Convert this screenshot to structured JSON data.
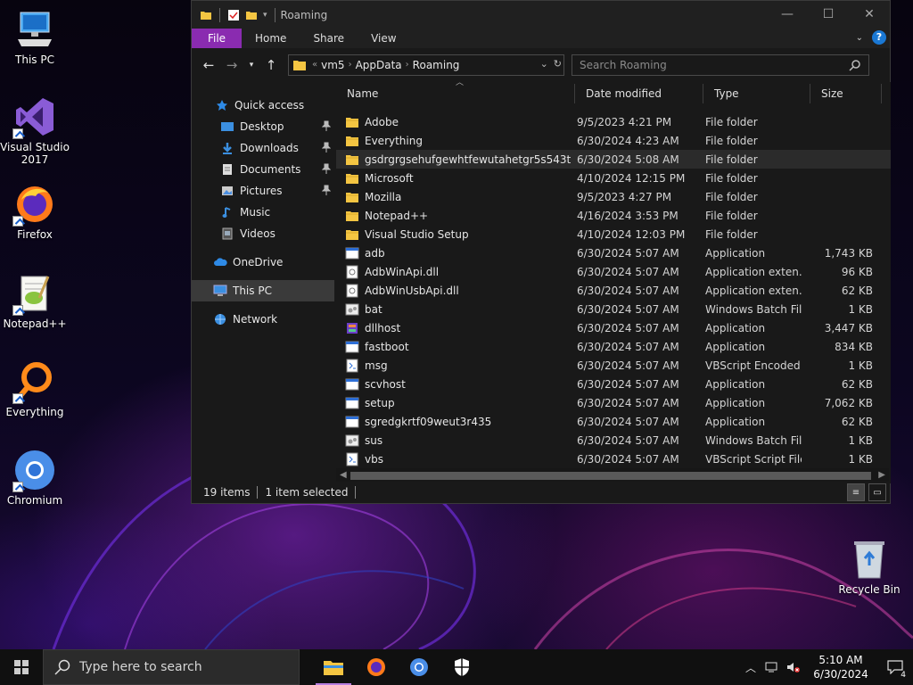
{
  "desktop": {
    "icons": [
      {
        "label": "This PC",
        "icon": "computer-icon"
      },
      {
        "label": "Visual Studio\n2017",
        "icon": "visual-studio-icon"
      },
      {
        "label": "Firefox",
        "icon": "firefox-icon"
      },
      {
        "label": "Notepad++",
        "icon": "notepadpp-icon"
      },
      {
        "label": "Everything",
        "icon": "everything-icon"
      },
      {
        "label": "Chromium",
        "icon": "chromium-icon"
      }
    ],
    "recycle_bin": "Recycle Bin"
  },
  "window": {
    "title": "Roaming",
    "ribbon_tabs": [
      "File",
      "Home",
      "Share",
      "View"
    ],
    "help_label": "?",
    "address": {
      "overflow": "«",
      "crumbs": [
        "vm5",
        "AppData",
        "Roaming"
      ]
    },
    "search": {
      "placeholder": "Search Roaming"
    },
    "nav_pane": {
      "items": [
        {
          "label": "Quick access",
          "icon": "star-icon"
        },
        {
          "label": "Desktop",
          "icon": "desktop-folder-icon",
          "pinned": true
        },
        {
          "label": "Downloads",
          "icon": "download-icon",
          "pinned": true
        },
        {
          "label": "Documents",
          "icon": "documents-icon",
          "pinned": true
        },
        {
          "label": "Pictures",
          "icon": "pictures-icon",
          "pinned": true
        },
        {
          "label": "Music",
          "icon": "music-icon"
        },
        {
          "label": "Videos",
          "icon": "videos-icon"
        },
        {
          "label": "OneDrive",
          "icon": "cloud-icon"
        },
        {
          "label": "This PC",
          "icon": "computer-icon",
          "selected": true
        },
        {
          "label": "Network",
          "icon": "network-icon"
        }
      ]
    },
    "columns": {
      "name": "Name",
      "date": "Date modified",
      "type": "Type",
      "size": "Size"
    },
    "files": [
      {
        "name": "Adobe",
        "date": "9/5/2023 4:21 PM",
        "type": "File folder",
        "size": "",
        "icon": "folder-icon"
      },
      {
        "name": "Everything",
        "date": "6/30/2024 4:23 AM",
        "type": "File folder",
        "size": "",
        "icon": "folder-icon"
      },
      {
        "name": "gsdrgrgsehufgewhtfewutahetgr5s543t",
        "date": "6/30/2024 5:08 AM",
        "type": "File folder",
        "size": "",
        "icon": "folder-icon",
        "selected": true
      },
      {
        "name": "Microsoft",
        "date": "4/10/2024 12:15 PM",
        "type": "File folder",
        "size": "",
        "icon": "folder-icon"
      },
      {
        "name": "Mozilla",
        "date": "9/5/2023 4:27 PM",
        "type": "File folder",
        "size": "",
        "icon": "folder-icon"
      },
      {
        "name": "Notepad++",
        "date": "4/16/2024 3:53 PM",
        "type": "File folder",
        "size": "",
        "icon": "folder-icon"
      },
      {
        "name": "Visual Studio Setup",
        "date": "4/10/2024 12:03 PM",
        "type": "File folder",
        "size": "",
        "icon": "folder-icon"
      },
      {
        "name": "adb",
        "date": "6/30/2024 5:07 AM",
        "type": "Application",
        "size": "1,743 KB",
        "icon": "exe-icon"
      },
      {
        "name": "AdbWinApi.dll",
        "date": "6/30/2024 5:07 AM",
        "type": "Application exten...",
        "size": "96 KB",
        "icon": "dll-icon"
      },
      {
        "name": "AdbWinUsbApi.dll",
        "date": "6/30/2024 5:07 AM",
        "type": "Application exten...",
        "size": "62 KB",
        "icon": "dll-icon"
      },
      {
        "name": "bat",
        "date": "6/30/2024 5:07 AM",
        "type": "Windows Batch File",
        "size": "1 KB",
        "icon": "batch-icon"
      },
      {
        "name": "dllhost",
        "date": "6/30/2024 5:07 AM",
        "type": "Application",
        "size": "3,447 KB",
        "icon": "installer-icon"
      },
      {
        "name": "fastboot",
        "date": "6/30/2024 5:07 AM",
        "type": "Application",
        "size": "834 KB",
        "icon": "exe-icon"
      },
      {
        "name": "msg",
        "date": "6/30/2024 5:07 AM",
        "type": "VBScript Encoded ...",
        "size": "1 KB",
        "icon": "script-icon"
      },
      {
        "name": "scvhost",
        "date": "6/30/2024 5:07 AM",
        "type": "Application",
        "size": "62 KB",
        "icon": "exe-icon"
      },
      {
        "name": "setup",
        "date": "6/30/2024 5:07 AM",
        "type": "Application",
        "size": "7,062 KB",
        "icon": "exe-icon"
      },
      {
        "name": "sgredgkrtf09weut3r435",
        "date": "6/30/2024 5:07 AM",
        "type": "Application",
        "size": "62 KB",
        "icon": "exe-icon"
      },
      {
        "name": "sus",
        "date": "6/30/2024 5:07 AM",
        "type": "Windows Batch File",
        "size": "1 KB",
        "icon": "batch-icon"
      },
      {
        "name": "vbs",
        "date": "6/30/2024 5:07 AM",
        "type": "VBScript Script File",
        "size": "1 KB",
        "icon": "script-icon"
      }
    ],
    "status": {
      "count": "19 items",
      "selected": "1 item selected"
    }
  },
  "taskbar": {
    "search_placeholder": "Type here to search",
    "apps": [
      "file-explorer-icon",
      "firefox-icon",
      "chromium-icon",
      "security-icon"
    ],
    "time": "5:10 AM",
    "date": "6/30/2024",
    "notification_count": "4"
  },
  "colors": {
    "accent": "#8a2bb0",
    "folder": "#f4c542",
    "selection": "#2b2b2b"
  }
}
